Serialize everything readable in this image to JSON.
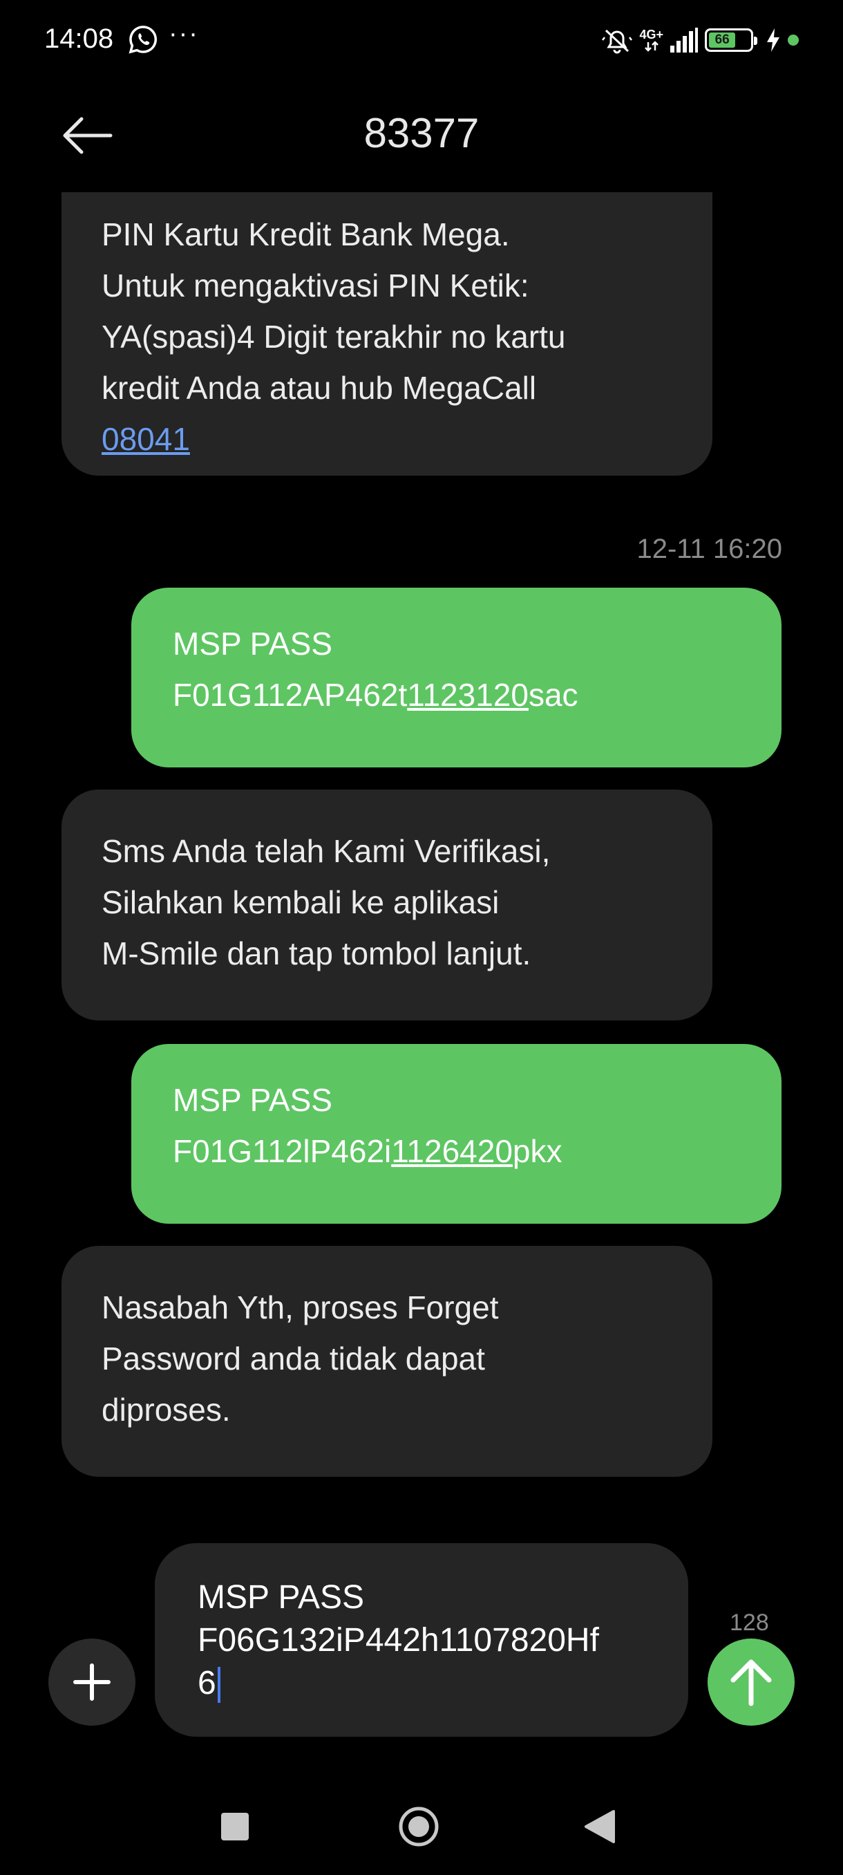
{
  "status_bar": {
    "time": "14:08",
    "more": "···",
    "network": "4G+",
    "battery": "66",
    "battery_level": 0.66,
    "accent_color": "#5ec563"
  },
  "header": {
    "title": "83377",
    "back_icon": "arrow-left-icon"
  },
  "messages": {
    "incoming_1": {
      "lines": [
        "PIN Kartu Kredit Bank Mega.",
        "Untuk mengaktivasi PIN Ketik:",
        "YA(spasi)4 Digit terakhir no kartu",
        "kredit Anda atau hub MegaCall"
      ],
      "link": "08041"
    },
    "timestamp": "12-11 16:20",
    "outgoing_1": {
      "line1": "MSP PASS",
      "prefix": "F01G112AP462t",
      "underlined": "1123120",
      "suffix": "sac"
    },
    "incoming_2": {
      "lines": [
        "Sms Anda telah Kami Verifikasi,",
        "Silahkan kembali ke aplikasi",
        "M-Smile dan tap tombol lanjut."
      ]
    },
    "outgoing_2": {
      "line1": "MSP PASS",
      "prefix": "F01G112lP462i",
      "underlined": "1126420",
      "suffix": "pkx"
    },
    "incoming_3": {
      "lines": [
        "Nasabah Yth, proses Forget",
        "Password anda tidak dapat",
        "diproses."
      ]
    }
  },
  "composer": {
    "lines": [
      "MSP PASS",
      "F06G132iP442h1107820Hf",
      "6"
    ],
    "char_count": "128",
    "add_icon": "plus-icon",
    "send_icon": "arrow-up-icon",
    "send_color": "#5ec563"
  },
  "nav_bar": {
    "icons": [
      "square-icon",
      "circle-home-icon",
      "triangle-back-icon"
    ]
  }
}
